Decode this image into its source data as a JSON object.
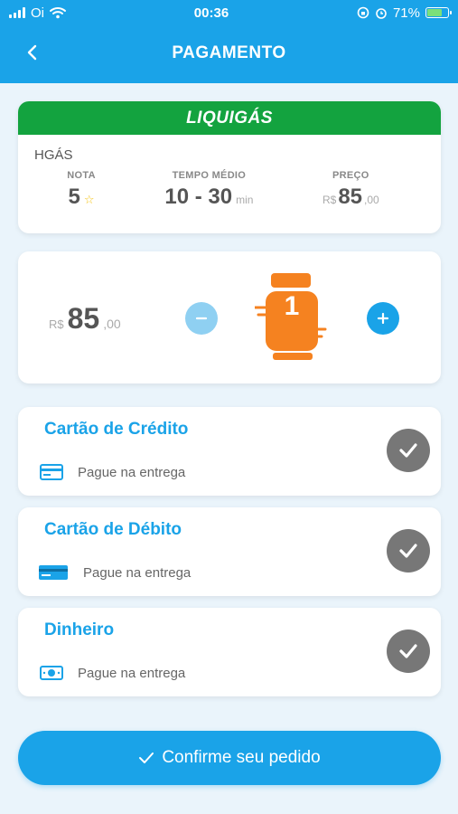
{
  "status_bar": {
    "carrier": "Oi",
    "time": "00:36",
    "battery_percent": "71%",
    "battery_level": 0.71
  },
  "header": {
    "title": "PAGAMENTO"
  },
  "distributor": {
    "brand": "LIQUIGÁS",
    "brand_color": "#13a33f",
    "seller": "HGÁS",
    "rating_label": "NOTA",
    "rating_value": "5",
    "time_label": "TEMPO MÉDIO",
    "time_value": "10 - 30",
    "time_unit": "min",
    "price_label": "PREÇO",
    "price_currency": "R$",
    "price_value": "85",
    "price_cents": ",00"
  },
  "quantity": {
    "price_currency": "R$",
    "price_value": "85",
    "price_cents": ",00",
    "count": "1",
    "minus_icon": "minus-icon",
    "plus_icon": "plus-icon"
  },
  "payment_methods": [
    {
      "title": "Cartão de Crédito",
      "description": "Pague na entrega",
      "icon": "credit-card-icon"
    },
    {
      "title": "Cartão de Débito",
      "description": "Pague na entrega",
      "icon": "debit-card-icon"
    },
    {
      "title": "Dinheiro",
      "description": "Pague na entrega",
      "icon": "cash-icon"
    }
  ],
  "confirm": {
    "label": "Confirme seu pedido"
  },
  "colors": {
    "primary": "#1aa3e8",
    "brand_green": "#13a33f",
    "cylinder_orange": "#f58220",
    "check_grey": "#777777"
  }
}
